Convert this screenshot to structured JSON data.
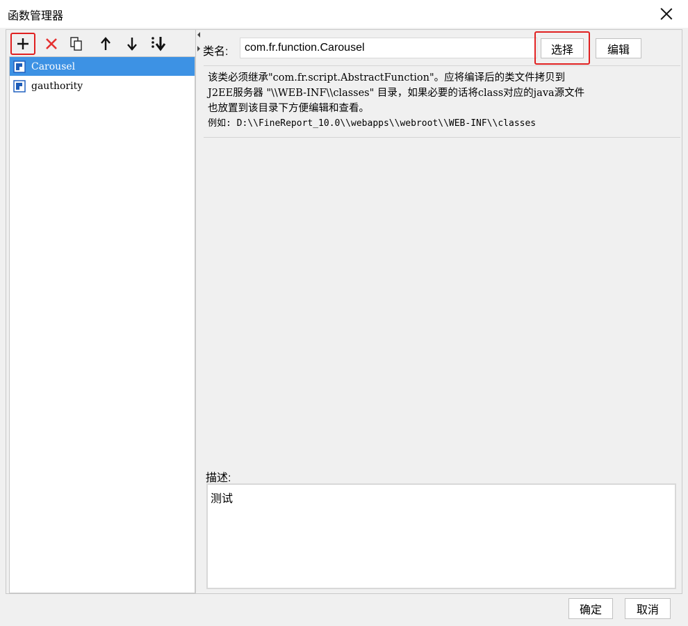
{
  "window": {
    "title": "函数管理器"
  },
  "toolbar": {
    "buttons": [
      {
        "name": "add",
        "icon": "plus-icon"
      },
      {
        "name": "delete",
        "icon": "x-icon"
      },
      {
        "name": "copy",
        "icon": "copy-icon"
      },
      {
        "name": "move-up",
        "icon": "arrow-up-icon"
      },
      {
        "name": "move-down",
        "icon": "arrow-down-icon"
      },
      {
        "name": "sort",
        "icon": "sort-icon"
      }
    ]
  },
  "function_list": {
    "items": [
      {
        "label": "Carousel",
        "selected": true
      },
      {
        "label": "gauthority",
        "selected": false
      }
    ]
  },
  "class_field": {
    "label": "类名:",
    "value": "com.fr.function.Carousel",
    "select_label": "选择",
    "edit_label": "编辑"
  },
  "info": {
    "line1": "该类必须继承\"com.fr.script.AbstractFunction\"。应将编译后的类文件拷贝到",
    "line2": "J2EE服务器 \"\\\\WEB-INF\\\\classes\" 目录，如果必要的话将class对应的java源文件",
    "line3": "也放置到该目录下方便编辑和查看。",
    "line4": "例如: D:\\\\FineReport_10.0\\\\webapps\\\\webroot\\\\WEB-INF\\\\classes"
  },
  "description": {
    "label": "描述:",
    "value": "测试"
  },
  "footer": {
    "ok_label": "确定",
    "cancel_label": "取消"
  },
  "colors": {
    "selection": "#3d92e4",
    "highlight_ring": "#e02020"
  }
}
